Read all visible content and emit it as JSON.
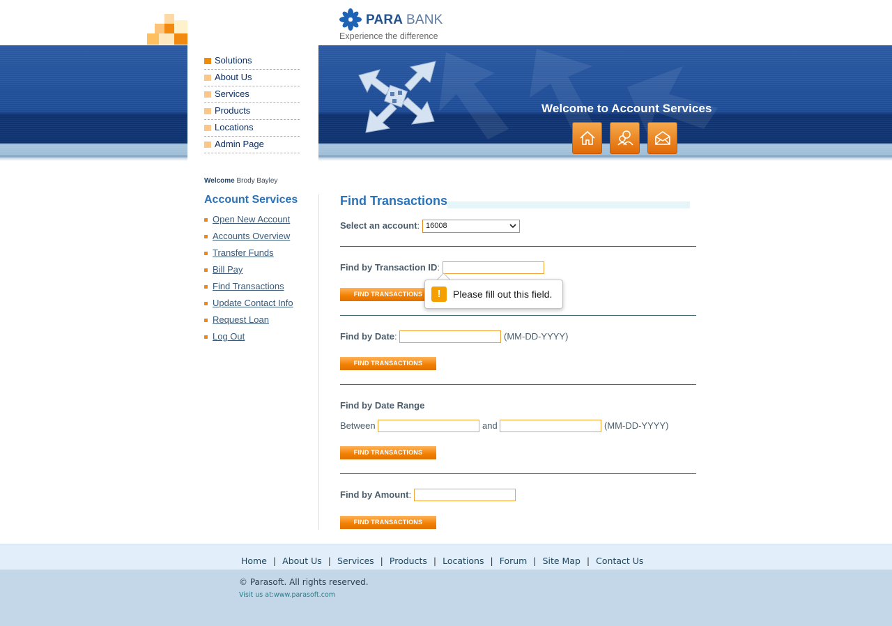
{
  "brand": {
    "name_part1": "PARA",
    "name_part2": "BANK",
    "tagline": "Experience the difference"
  },
  "header": {
    "nav_items": [
      "Solutions",
      "About Us",
      "Services",
      "Products",
      "Locations",
      "Admin Page"
    ],
    "welcome_title": "Welcome to Account Services",
    "icons": [
      "home-icon",
      "contact-icon",
      "mail-icon"
    ]
  },
  "sidebar": {
    "welcome_label": "Welcome",
    "user_name": "Brody Bayley",
    "title": "Account Services",
    "links": [
      "Open New Account",
      "Accounts Overview",
      "Transfer Funds",
      "Bill Pay",
      "Find Transactions",
      "Update Contact Info",
      "Request Loan",
      "Log Out"
    ]
  },
  "main": {
    "title": "Find Transactions",
    "select_account_label": "Select an account",
    "selected_account": "16008",
    "find_by_id_label": "Find by Transaction ID",
    "find_by_date_label": "Find by Date",
    "date_format_hint": "(MM-DD-YYYY)",
    "find_by_range_label": "Find by Date Range",
    "between_label": "Between",
    "and_label": "and",
    "find_by_amount_label": "Find by Amount",
    "button_label": "FIND TRANSACTIONS",
    "colon": ":",
    "id_value": "",
    "date_value": "",
    "range_from_value": "",
    "range_to_value": "",
    "amount_value": ""
  },
  "tooltip": {
    "icon": "!",
    "message": "Please fill out this field."
  },
  "footer": {
    "links": [
      "Home",
      "About Us",
      "Services",
      "Products",
      "Locations",
      "Forum",
      "Site Map",
      "Contact Us"
    ],
    "separator": "|",
    "copyright": "© Parasoft. All rights reserved.",
    "visit_text": "Visit us at:www.parasoft.com"
  },
  "colors": {
    "header_blue": "#1d4b95",
    "accent_orange": "#f08a0b",
    "title_blue": "#2a73b8",
    "footer_light": "#e2effb",
    "footer_dark": "#c4d7e9"
  }
}
